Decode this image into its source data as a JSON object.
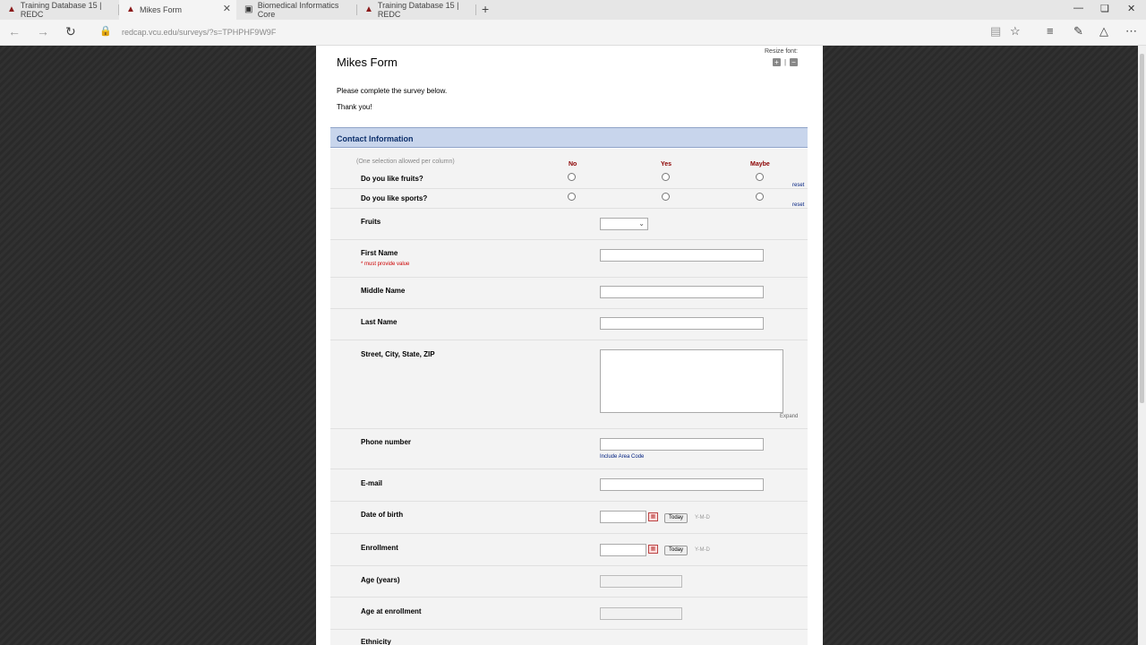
{
  "browser": {
    "tabs": [
      {
        "title": "Training Database 15 | REDC",
        "active": false
      },
      {
        "title": "Mikes Form",
        "active": true
      },
      {
        "title": "Biomedical Informatics Core",
        "active": false
      },
      {
        "title": "Training Database 15 | REDC",
        "active": false
      }
    ],
    "url": "redcap.vcu.edu/surveys/?s=TPHPHF9W9F"
  },
  "survey": {
    "title": "Mikes Form",
    "resize_label": "Resize font:",
    "intro_line1": "Please complete the survey below.",
    "intro_line2": "Thank you!",
    "section_header": "Contact Information"
  },
  "matrix": {
    "note": "(One selection allowed per column)",
    "columns": [
      "No",
      "Yes",
      "Maybe"
    ],
    "rows": [
      "Do you like fruits?",
      "Do you like sports?"
    ],
    "reset_label": "reset"
  },
  "fields": {
    "fruits": {
      "label": "Fruits",
      "value": ""
    },
    "first_name": {
      "label": "First Name",
      "required_note": "* must provide value",
      "value": ""
    },
    "middle_name": {
      "label": "Middle Name",
      "value": ""
    },
    "last_name": {
      "label": "Last Name",
      "value": ""
    },
    "address": {
      "label": "Street, City, State, ZIP",
      "value": "",
      "expand_label": "Expand"
    },
    "phone": {
      "label": "Phone number",
      "value": "",
      "note": "Include Area Code"
    },
    "email": {
      "label": "E-mail",
      "value": ""
    },
    "dob": {
      "label": "Date of birth",
      "value": "",
      "today_label": "Today",
      "format": "Y-M-D"
    },
    "enrollment": {
      "label": "Enrollment",
      "value": "",
      "today_label": "Today",
      "format": "Y-M-D"
    },
    "age": {
      "label": "Age (years)",
      "value": ""
    },
    "age_enrollment": {
      "label": "Age at enrollment",
      "value": ""
    },
    "ethnicity": {
      "label": "Ethnicity"
    }
  }
}
